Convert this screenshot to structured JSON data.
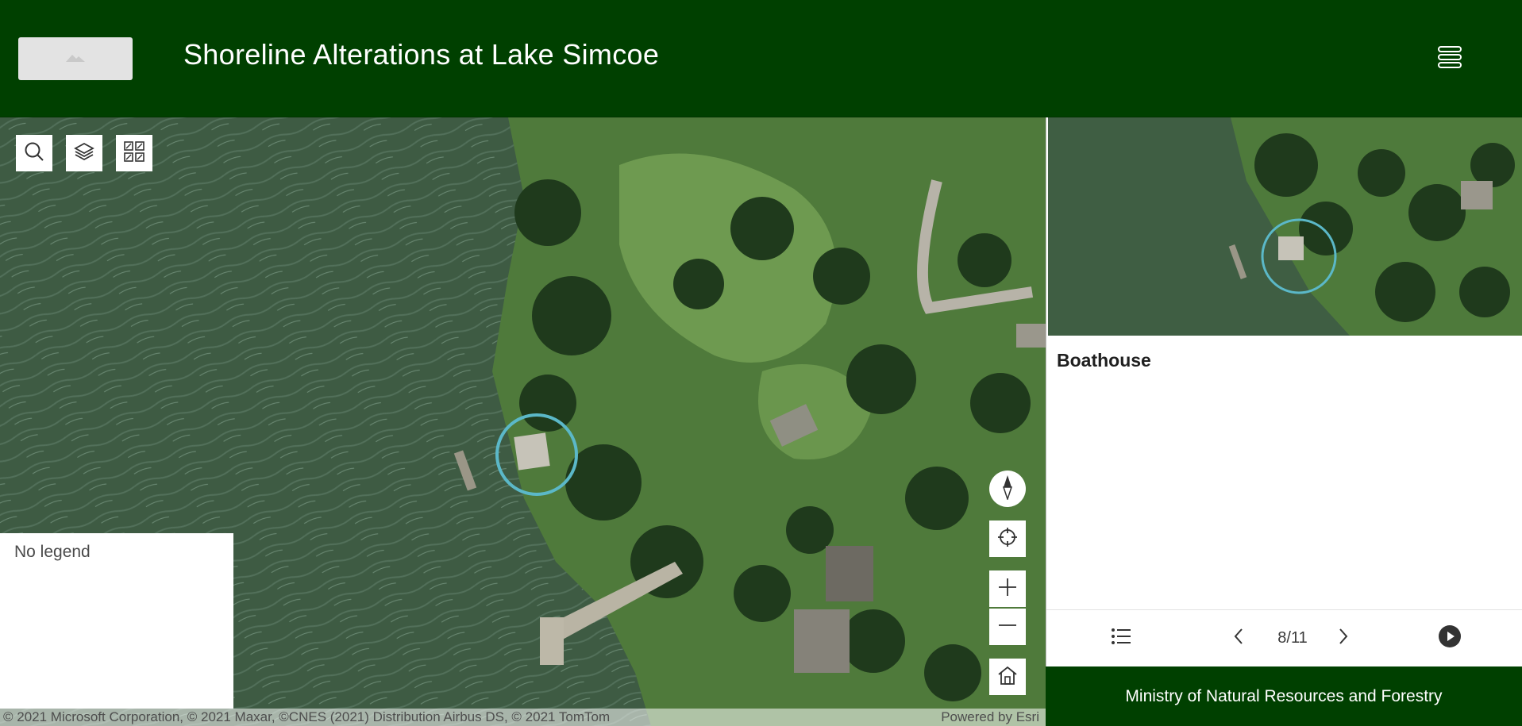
{
  "header": {
    "title": "Shoreline Alterations at Lake Simcoe",
    "logo_icon": "image-placeholder-icon",
    "menu_icon": "stacked-menu-icon",
    "background_color": "#004000"
  },
  "map": {
    "toolbar": [
      {
        "name": "search-button",
        "icon": "search-icon"
      },
      {
        "name": "layers-button",
        "icon": "layers-icon"
      },
      {
        "name": "basemap-gallery-button",
        "icon": "basemap-gallery-icon"
      }
    ],
    "legend": {
      "text": "No legend"
    },
    "controls": [
      {
        "name": "compass-button",
        "icon": "compass-icon"
      },
      {
        "name": "locate-button",
        "icon": "locate-crosshair-icon"
      },
      {
        "name": "zoom-in-button",
        "icon": "plus-icon"
      },
      {
        "name": "zoom-out-button",
        "icon": "minus-icon"
      },
      {
        "name": "home-button",
        "icon": "home-icon"
      }
    ],
    "attribution": "© 2021 Microsoft Corporation, © 2021 Maxar, ©CNES (2021) Distribution Airbus DS, © 2021 TomTom",
    "powered_by": "Powered by Esri",
    "highlight_color": "#5bb8c8"
  },
  "side_panel": {
    "feature_title": "Boathouse",
    "counter": "8/11",
    "nav_icons": [
      "list-icon",
      "chevron-left-icon",
      "chevron-right-icon",
      "play-icon"
    ],
    "footer": "Ministry of Natural Resources and Forestry"
  }
}
